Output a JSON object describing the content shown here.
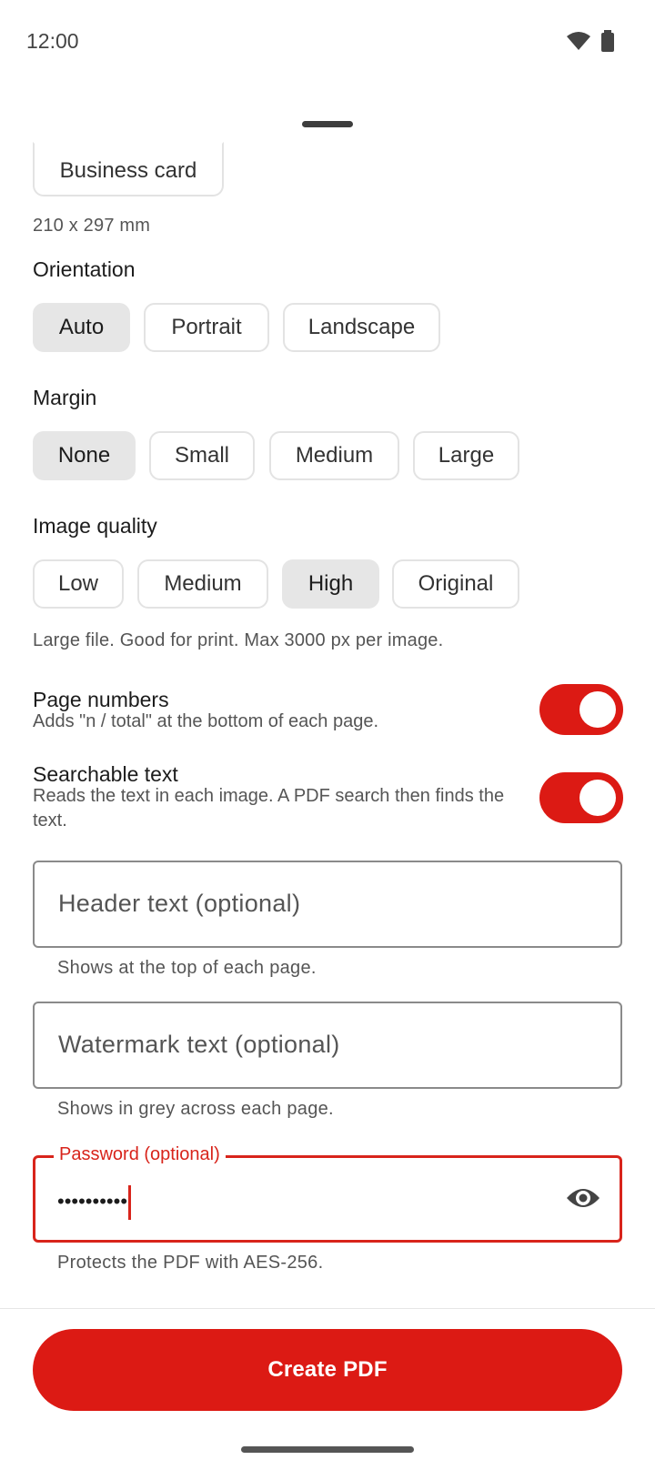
{
  "status_bar": {
    "time": "12:00",
    "icons": [
      "wifi-icon",
      "battery-icon"
    ]
  },
  "page_size": {
    "chip_label": "Business card",
    "dimensions": "210 x 297 mm"
  },
  "orientation": {
    "label": "Orientation",
    "options": [
      {
        "label": "Auto",
        "selected": true
      },
      {
        "label": "Portrait",
        "selected": false
      },
      {
        "label": "Landscape",
        "selected": false
      }
    ]
  },
  "margin": {
    "label": "Margin",
    "options": [
      {
        "label": "None",
        "selected": true
      },
      {
        "label": "Small",
        "selected": false
      },
      {
        "label": "Medium",
        "selected": false
      },
      {
        "label": "Large",
        "selected": false
      }
    ]
  },
  "image_quality": {
    "label": "Image quality",
    "options": [
      {
        "label": "Low",
        "selected": false
      },
      {
        "label": "Medium",
        "selected": false
      },
      {
        "label": "High",
        "selected": true
      },
      {
        "label": "Original",
        "selected": false
      }
    ],
    "hint": "Large file. Good for print. Max 3000 px per image."
  },
  "toggles": {
    "page_numbers": {
      "title": "Page numbers",
      "description": "Adds \"n / total\" at the bottom of each page.",
      "on": true
    },
    "searchable_text": {
      "title": "Searchable text",
      "description": "Reads the text in each image. A PDF search then finds the text.",
      "on": true
    }
  },
  "fields": {
    "header": {
      "placeholder": "Header text (optional)",
      "value": "",
      "helper": "Shows at the top of each page."
    },
    "watermark": {
      "placeholder": "Watermark text (optional)",
      "value": "",
      "helper": "Shows in grey across each page."
    },
    "password": {
      "label": "Password (optional)",
      "masked_value": "••••••••••",
      "helper": "Protects the PDF with AES-256.",
      "visibility_icon": "eye-icon"
    }
  },
  "actions": {
    "create_label": "Create PDF"
  },
  "colors": {
    "accent": "#dc1a14",
    "chip_selected": "#e6e6e6",
    "chip_border": "#e3e3e3"
  }
}
